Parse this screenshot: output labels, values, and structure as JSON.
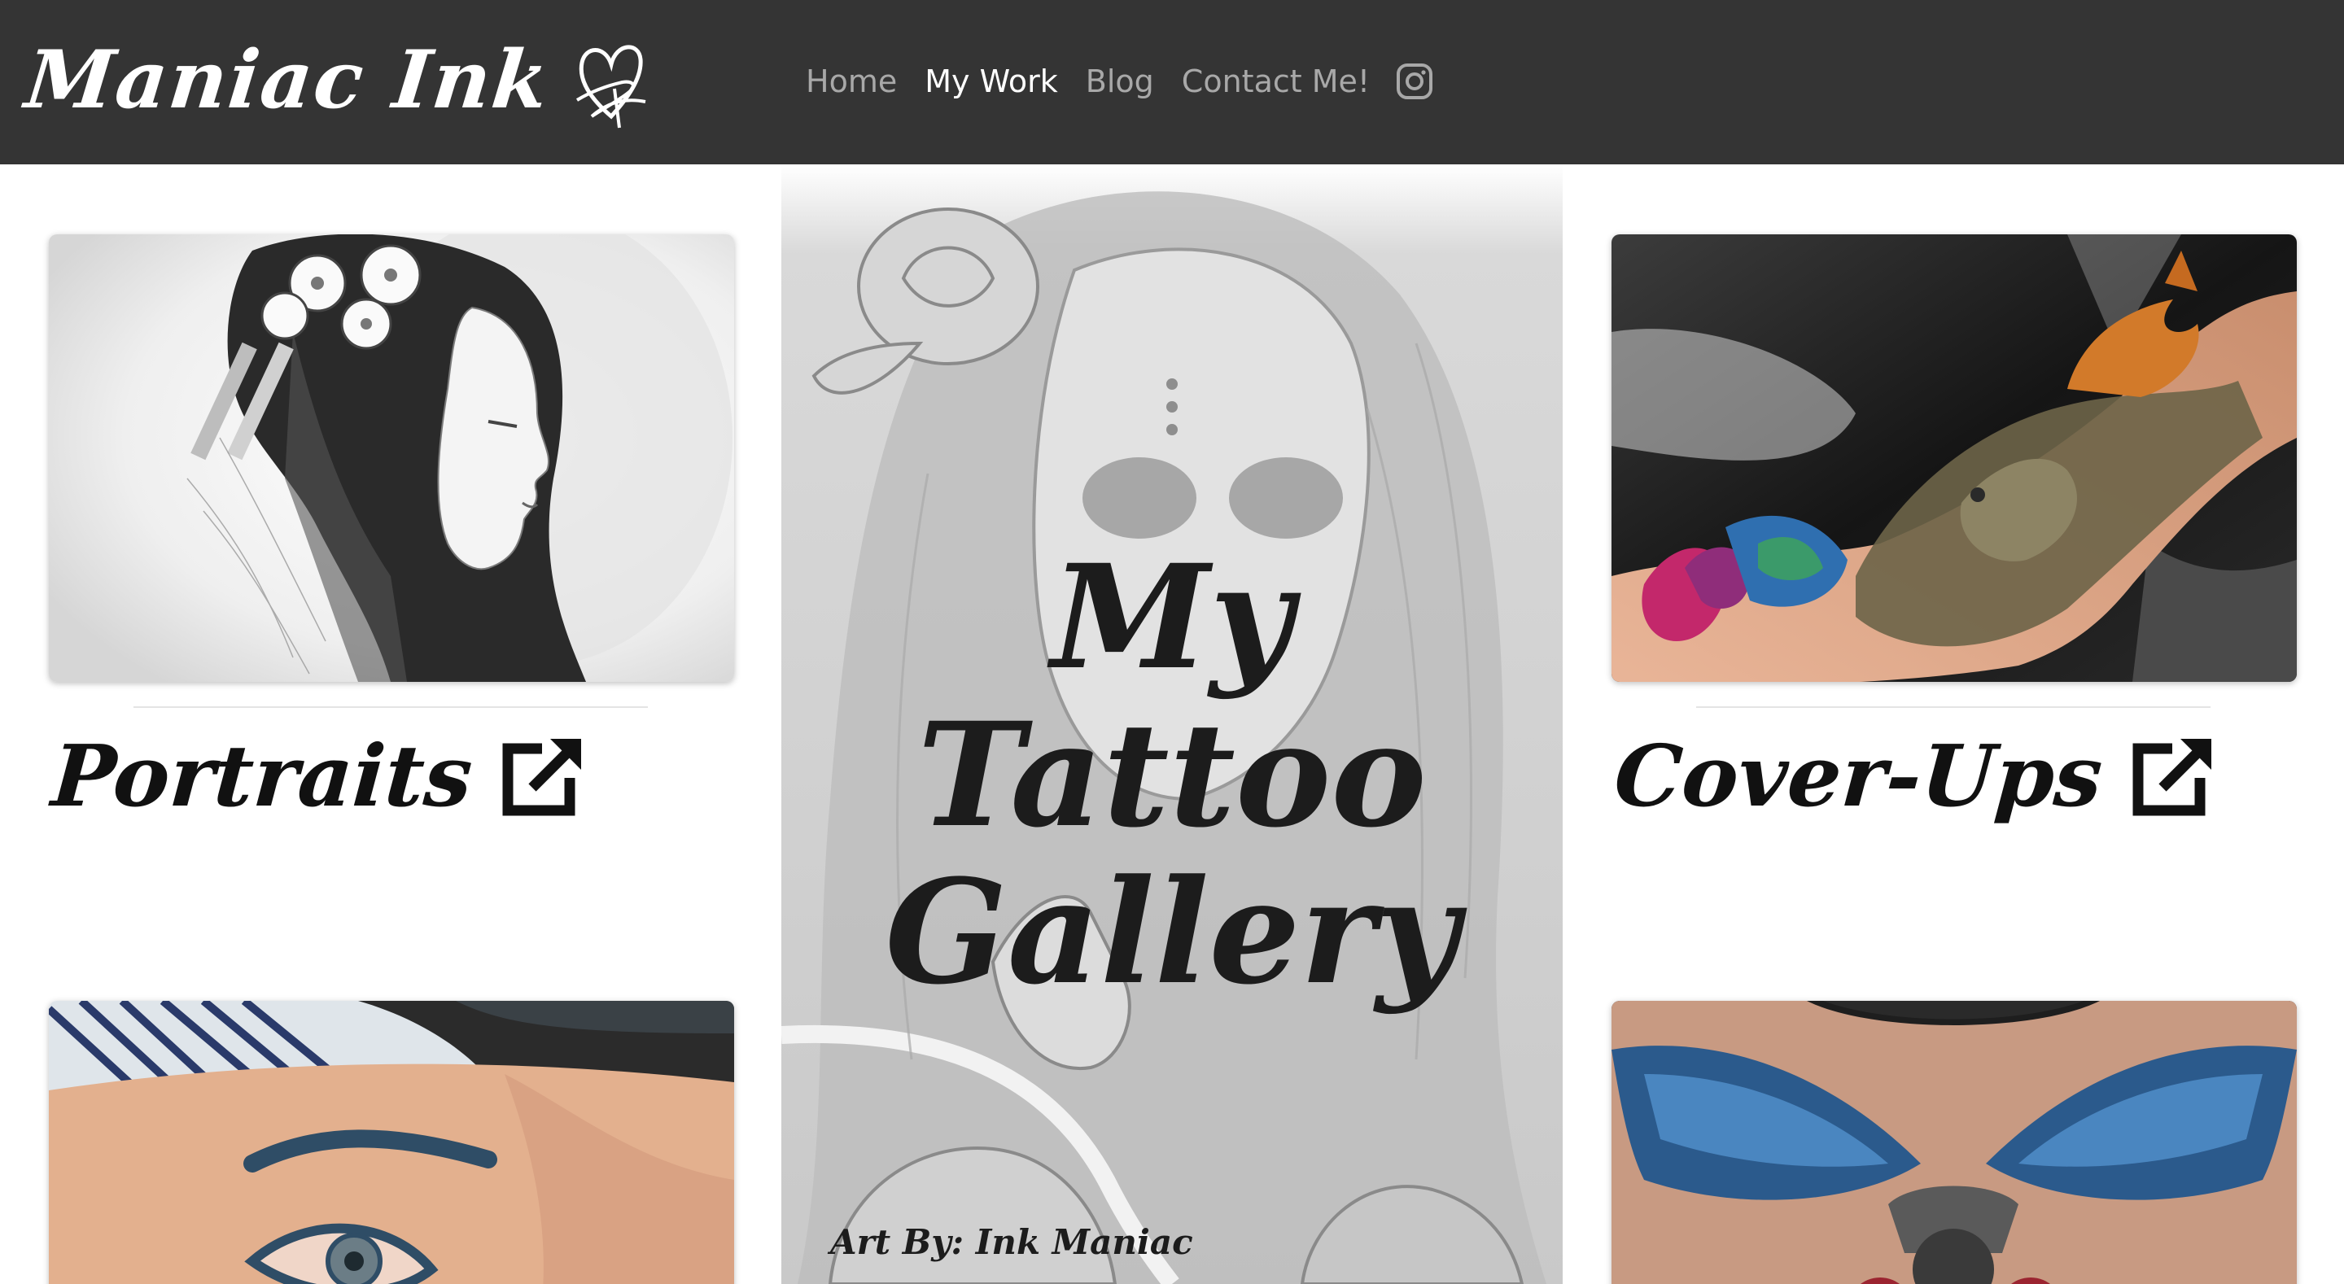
{
  "brand": {
    "name": "Maniac Ink",
    "logo_icon": "heart-signature-icon"
  },
  "nav": {
    "items": [
      {
        "label": "Home",
        "active": false
      },
      {
        "label": "My Work",
        "active": true
      },
      {
        "label": "Blog",
        "active": false
      },
      {
        "label": "Contact Me!",
        "active": false
      }
    ],
    "social_icon": "instagram-icon"
  },
  "galleries": [
    {
      "label": "Portraits",
      "image": "black and white pencil portrait of a geisha with flowers in her hair",
      "link_icon": "external-link-icon"
    },
    {
      "label": "Cover-Ups",
      "image": "colorful lion and butterfly tattoo on a foot",
      "link_icon": "external-link-icon"
    }
  ],
  "lower_cards": [
    {
      "image": "eye tattoo on a forearm"
    },
    {
      "image": "blue winged chest tattoo"
    }
  ],
  "hero": {
    "title_line1": "My Tattoo",
    "title_line2": "Gallery",
    "credit": "Art By: Ink Maniac",
    "background": "faded sugar skull woman with rose illustration"
  },
  "colors": {
    "navbar": "#343434",
    "nav_inactive": "#a8a8a8",
    "nav_active": "#ffffff",
    "heading": "#111111"
  }
}
